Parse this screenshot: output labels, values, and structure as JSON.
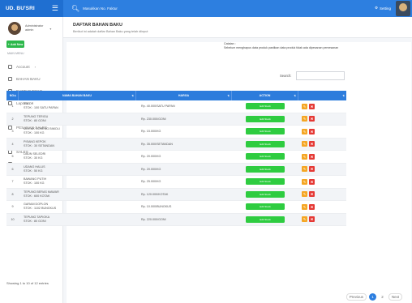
{
  "brand": {
    "title": "UD. BU'SRI"
  },
  "topbar": {
    "search_placeholder": "Masukkan No. Faktur",
    "setting_label": "Setting"
  },
  "user": {
    "name": "Administrator",
    "role": "admin"
  },
  "sidebar": {
    "section_label": "MAIN MENU",
    "items": [
      {
        "label": "Account",
        "has_sub": true
      },
      {
        "label": "BAHAN BAKU",
        "has_sub": false
      },
      {
        "label": "DAFTAR TOKO",
        "has_sub": false
      },
      {
        "label": "Laporan",
        "has_sub": false
      },
      {
        "label": "PEMESANAN BAHAN",
        "has_sub": false
      },
      {
        "label": "PESANAN SALES",
        "has_sub": false
      },
      {
        "label": "PRODUKSI",
        "has_sub": false
      },
      {
        "label": "SALES",
        "has_sub": false
      },
      {
        "label": "SUPPLIER",
        "has_sub": false
      }
    ]
  },
  "page": {
    "title": "DAFTAR BAHAN BAKU",
    "subtitle": "Berikut ini adalah daftar Bahan Baku yang telah diinput",
    "add_button": "Add New",
    "note_title": "Catatan :",
    "note_text": "Sebelum menghapus data produk pastikan data produk tidak ada dipesanan pemesanan",
    "search_label": "Search:"
  },
  "table": {
    "headers": {
      "no": "NO.",
      "nama": "NAMA BAHAN BAKU",
      "harga": "HARGA",
      "action": "ACTION"
    },
    "action_label": "Edit Stock",
    "rows": [
      {
        "no": "1",
        "nama": "TELOR",
        "stok": "STOK : 100 SATU PAPAN",
        "harga": "Rp. 40.000/SATU PAPAN"
      },
      {
        "no": "2",
        "nama": "TEPUNG TERIGU",
        "stok": "STOK : 80 GONI",
        "harga": "Rp. 230.000/GONI"
      },
      {
        "no": "3",
        "nama": "MINYAK GORENG BIMOLI",
        "stok": "STOK : 100 KG",
        "harga": "Rp. 15.000/KG"
      },
      {
        "no": "4",
        "nama": "PISANG KEPOK",
        "stok": "STOK : 30 SETANDAN",
        "harga": "Rp. 35.000/SETANDAN"
      },
      {
        "no": "5",
        "nama": "DAUN SELEDRI",
        "stok": "STOK : 30 KG",
        "harga": "Rp. 20.000/KG"
      },
      {
        "no": "6",
        "nama": "UDANG HALUS",
        "stok": "STOK : 50 KG",
        "harga": "Rp. 20.000/KG"
      },
      {
        "no": "7",
        "nama": "BAWANG PUTIH",
        "stok": "STOK : 100 KG",
        "harga": "Rp. 25.000/KG"
      },
      {
        "no": "8",
        "nama": "TEPUNG BERAS MAWAR",
        "stok": "STOK : 600 KOTAK",
        "harga": "Rp. 120.000/KOTAK"
      },
      {
        "no": "9",
        "nama": "GARAM DOPLON",
        "stok": "STOK : 1102 BUNGKUS",
        "harga": "Rp. 10.000/BUNGKUS"
      },
      {
        "no": "10",
        "nama": "TEPUNG TAPIOKA",
        "stok": "STOK : 80 GONI",
        "harga": "Rp. 220.000/GONI"
      }
    ],
    "showing": "Showing 1 to 10 of 12 entries"
  },
  "pagination": {
    "previous": "Previous",
    "pages": [
      "1",
      "2"
    ],
    "active": "1",
    "next": "Next"
  },
  "colors": {
    "primary": "#2d7fe0",
    "success": "#2ecc40",
    "warning": "#f5a623",
    "danger": "#e53935"
  }
}
